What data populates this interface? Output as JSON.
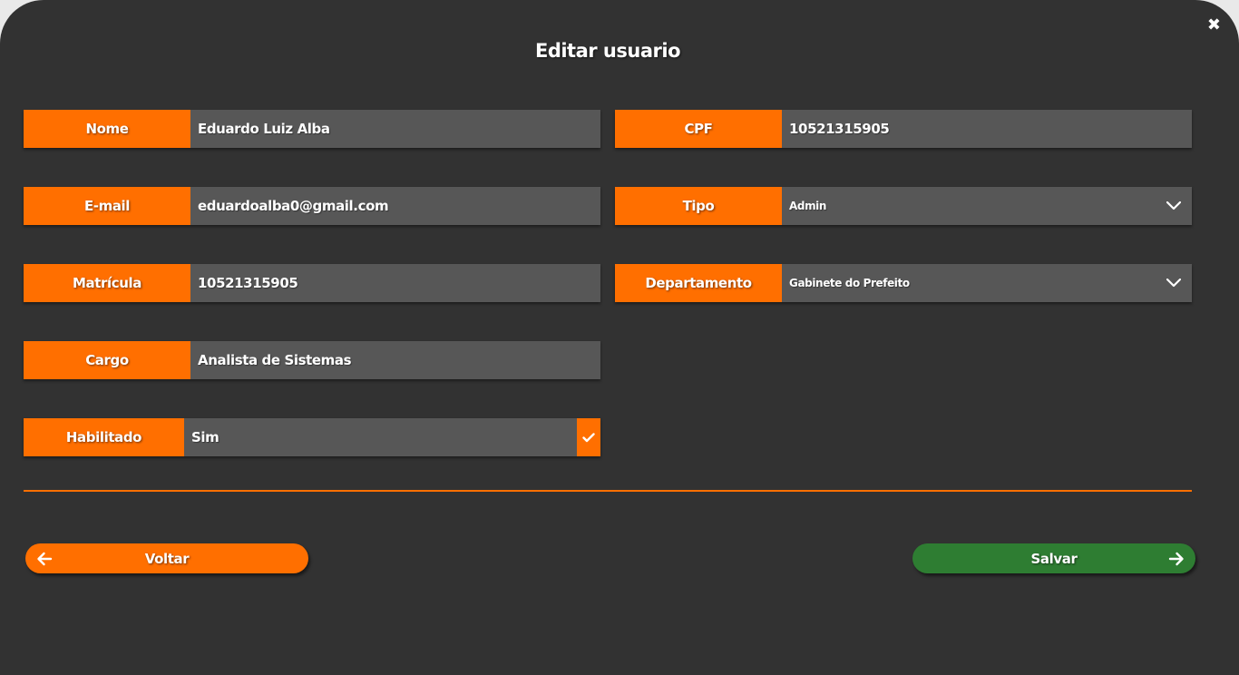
{
  "dialog": {
    "title": "Editar usuario",
    "close_icon": "close-icon"
  },
  "fields": {
    "nome": {
      "label": "Nome",
      "value": "Eduardo Luiz Alba"
    },
    "cpf": {
      "label": "CPF",
      "value": "10521315905"
    },
    "email": {
      "label": "E-mail",
      "value": "eduardoalba0@gmail.com"
    },
    "tipo": {
      "label": "Tipo",
      "value": "Admin"
    },
    "matricula": {
      "label": "Matrícula",
      "value": "10521315905"
    },
    "departamento": {
      "label": "Departamento",
      "value": "Gabinete do Prefeito"
    },
    "cargo": {
      "label": "Cargo",
      "value": "Analista de Sistemas"
    },
    "habilitado": {
      "label": "Habilitado",
      "value": "Sim",
      "checked": true
    }
  },
  "actions": {
    "back_label": "Voltar",
    "save_label": "Salvar"
  },
  "colors": {
    "accent": "#ff6f00",
    "background": "#323232",
    "field_bg": "#575757",
    "save": "#2e7d32"
  }
}
